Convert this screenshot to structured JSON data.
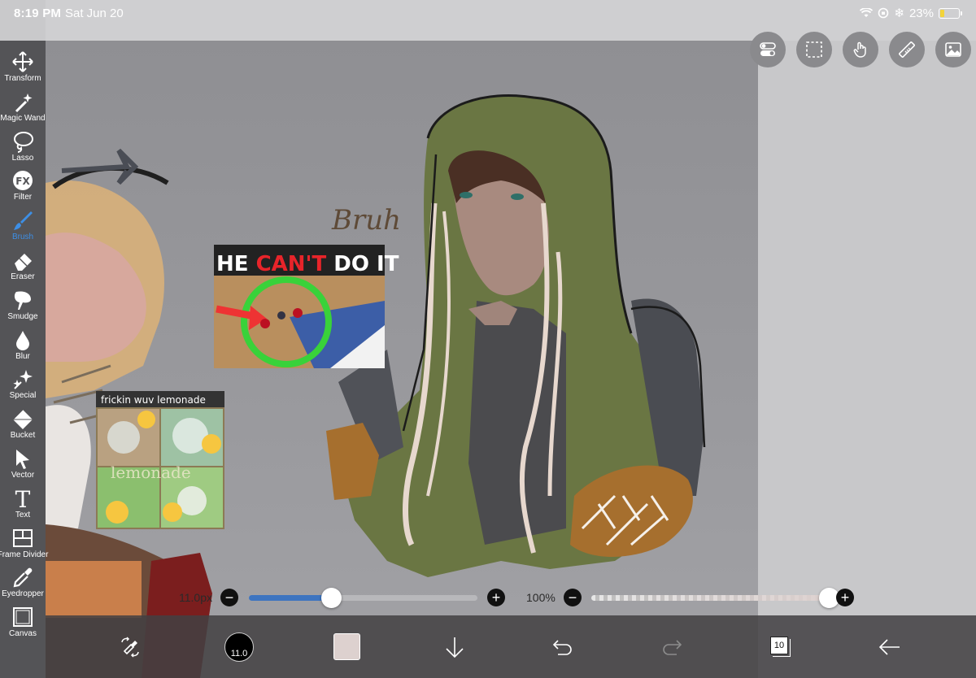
{
  "status_bar": {
    "time": "8:19 PM",
    "date": "Sat Jun 20",
    "battery": "23%",
    "battery_level": 0.23
  },
  "toolbar": {
    "tools": [
      {
        "label": "Transform",
        "icon": "move-arrows-icon"
      },
      {
        "label": "Magic Wand",
        "icon": "magic-wand-icon"
      },
      {
        "label": "Lasso",
        "icon": "lasso-icon"
      },
      {
        "label": "Filter",
        "icon": "fx-icon",
        "glyph": "FX"
      },
      {
        "label": "Brush",
        "icon": "brush-icon",
        "active": true
      },
      {
        "label": "Eraser",
        "icon": "eraser-icon"
      },
      {
        "label": "Smudge",
        "icon": "smudge-icon"
      },
      {
        "label": "Blur",
        "icon": "droplet-icon"
      },
      {
        "label": "Special",
        "icon": "sparkle-icon"
      },
      {
        "label": "Bucket",
        "icon": "bucket-icon"
      },
      {
        "label": "Vector",
        "icon": "cursor-arrow-icon"
      },
      {
        "label": "Text",
        "icon": "text-icon",
        "glyph": "T"
      },
      {
        "label": "Frame Divider",
        "icon": "frame-divider-icon"
      },
      {
        "label": "Eyedropper",
        "icon": "eyedropper-icon"
      },
      {
        "label": "Canvas",
        "icon": "canvas-icon"
      }
    ],
    "accent_color": "#3d8fe6"
  },
  "top_right_buttons": [
    {
      "icon": "toggle-switches-icon"
    },
    {
      "icon": "selection-rect-icon"
    },
    {
      "icon": "touch-hand-icon"
    },
    {
      "icon": "ruler-icon"
    },
    {
      "icon": "image-icon"
    }
  ],
  "artwork": {
    "handwriting": "Bruh",
    "meme1": {
      "text_before": "HE ",
      "text_highlight": "CAN'T",
      "text_after": " DO IT"
    },
    "meme2": {
      "caption": "frickin wuv lemonade",
      "watermark": "lemonade"
    }
  },
  "brush_size_slider": {
    "value_label": "11.0px",
    "minus": "−",
    "plus": "+",
    "fraction": 0.36,
    "fill_color": "#3d74c0"
  },
  "opacity_slider": {
    "value_label": "100%",
    "minus": "−",
    "plus": "+",
    "fraction": 1.0
  },
  "bottom_bar": {
    "brush_size": "11.0",
    "current_color": "#ddd1cf",
    "layer_count": "10"
  }
}
